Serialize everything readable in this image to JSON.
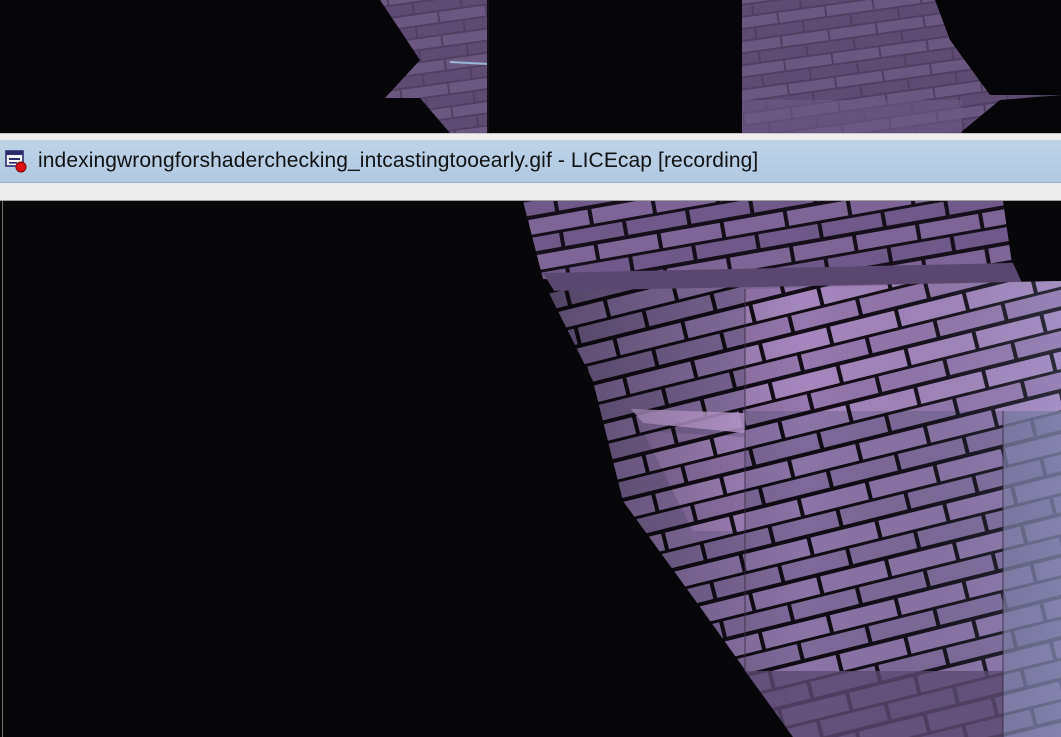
{
  "window": {
    "title": "indexingwrongforshaderchecking_intcastingtooearly.gif - LICEcap [recording]",
    "app_icon": "licecap-recording-icon",
    "state": "recording"
  },
  "colors": {
    "titlebar": "#b7cde3",
    "frame": "#ececec",
    "background": "#070609",
    "brick_dark": "#5e4d72",
    "brick_mid": "#8a6fa3",
    "brick_light": "#b394c9",
    "mortar": "#120d16",
    "record_dot": "#e01010"
  }
}
